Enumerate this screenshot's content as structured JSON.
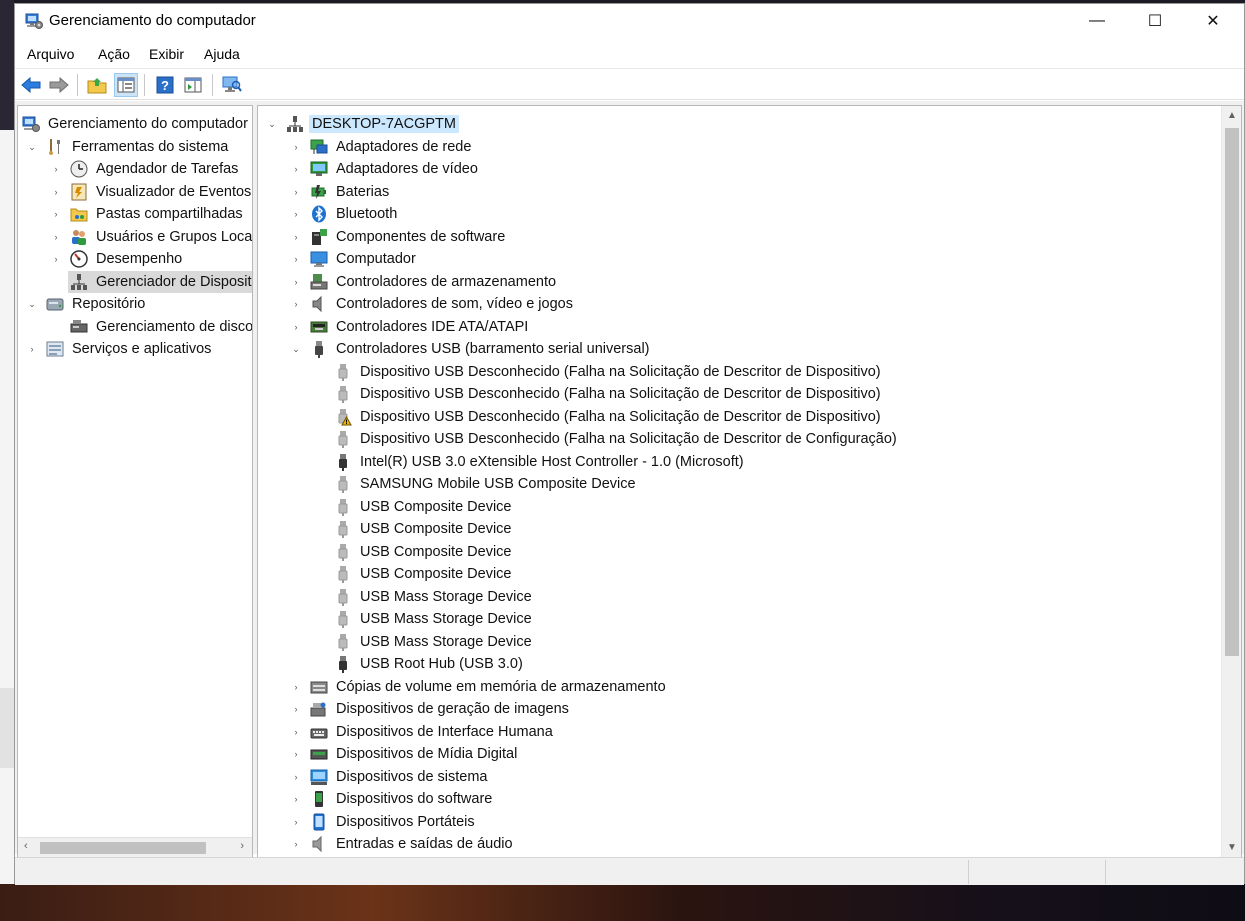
{
  "window": {
    "title": "Gerenciamento do computador",
    "minimize": "—",
    "maximize": "☐",
    "close": "✕"
  },
  "menu": {
    "items": [
      "Arquivo",
      "Ação",
      "Exibir",
      "Ajuda"
    ]
  },
  "left_tree": {
    "root": "Gerenciamento do computador",
    "system_tools": "Ferramentas do sistema",
    "task_scheduler": "Agendador de Tarefas",
    "event_viewer": "Visualizador de Eventos",
    "shared_folders": "Pastas compartilhadas",
    "local_users": "Usuários e Grupos Locai",
    "performance": "Desempenho",
    "device_manager": "Gerenciador de Disposit",
    "storage": "Repositório",
    "disk_management": "Gerenciamento de disco",
    "services": "Serviços e aplicativos"
  },
  "device_tree": {
    "computer_name": "DESKTOP-7ACGPTM",
    "categories_top": [
      "Adaptadores de rede",
      "Adaptadores de vídeo",
      "Baterias",
      "Bluetooth",
      "Componentes de software",
      "Computador",
      "Controladores de armazenamento",
      "Controladores de som, vídeo e jogos",
      "Controladores IDE ATA/ATAPI"
    ],
    "usb_category": "Controladores USB (barramento serial universal)",
    "usb_devices": [
      "Dispositivo USB Desconhecido (Falha na Solicitação de Descritor de Dispositivo)",
      "Dispositivo USB Desconhecido (Falha na Solicitação de Descritor de Dispositivo)",
      "Dispositivo USB Desconhecido (Falha na Solicitação de Descritor de Dispositivo)",
      "Dispositivo USB Desconhecido (Falha na Solicitação de Descritor de Configuração)",
      "Intel(R) USB 3.0 eXtensible Host Controller - 1.0 (Microsoft)",
      "SAMSUNG Mobile USB Composite Device",
      "USB Composite Device",
      "USB Composite Device",
      "USB Composite Device",
      "USB Composite Device",
      "USB Mass Storage Device",
      "USB Mass Storage Device",
      "USB Mass Storage Device",
      "USB Root Hub (USB 3.0)"
    ],
    "categories_bottom": [
      "Cópias de volume em memória de armazenamento",
      "Dispositivos de geração de imagens",
      "Dispositivos de Interface Humana",
      "Dispositivos de Mídia Digital",
      "Dispositivos de sistema",
      "Dispositivos do software",
      "Dispositivos Portáteis",
      "Entradas e saídas de áudio"
    ]
  },
  "colors": {
    "selection": "#cce8ff",
    "warning": "#f2b600",
    "accent_blue": "#1e73d2"
  }
}
